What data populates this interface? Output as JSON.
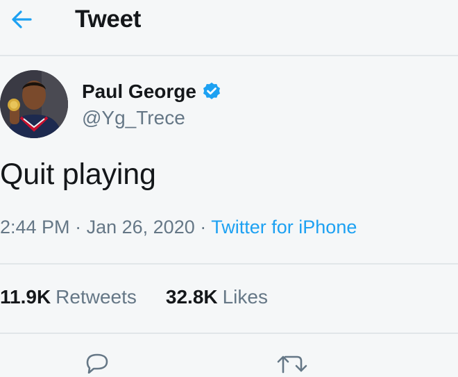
{
  "header": {
    "title": "Tweet",
    "back_icon": "arrow-left-icon",
    "accent": "#1da1f2"
  },
  "tweet": {
    "author": {
      "name": "Paul George",
      "handle": "@Yg_Trece",
      "verified": true,
      "verified_icon": "verified-badge-icon"
    },
    "text": "Quit playing",
    "time": "2:44 PM",
    "date": "Jan 26, 2020",
    "separator": "·",
    "source": "Twitter for iPhone"
  },
  "stats": {
    "retweets": {
      "count": "11.9K",
      "label": "Retweets"
    },
    "likes": {
      "count": "32.8K",
      "label": "Likes"
    }
  },
  "actions": [
    {
      "icon": "reply-icon"
    },
    {
      "icon": "retweet-icon"
    }
  ],
  "colors": {
    "text": "#14171a",
    "secondary": "#657786",
    "divider": "#e1e6e9",
    "background": "#f5f7f8"
  }
}
